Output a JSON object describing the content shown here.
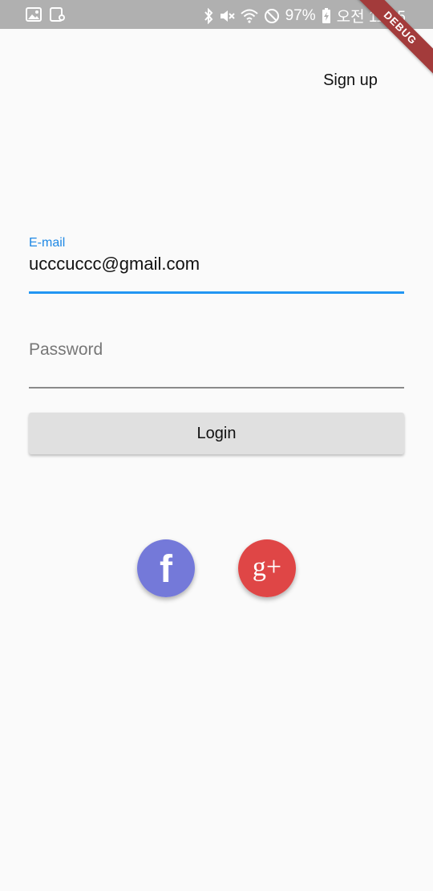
{
  "status_bar": {
    "battery": "97%",
    "time": "오전 11:45",
    "icons": [
      "gallery-icon",
      "screenshot-icon",
      "bluetooth-icon",
      "mute-icon",
      "wifi-icon",
      "do-not-disturb-icon",
      "battery-charging-icon"
    ]
  },
  "debug_banner": "DEBUG",
  "header": {
    "signup_label": "Sign up"
  },
  "form": {
    "email_label": "E-mail",
    "email_value": "ucccuccc@gmail.com",
    "password_placeholder": "Password",
    "login_label": "Login"
  },
  "social": {
    "facebook": {
      "glyph": "f",
      "color": "#7479d9"
    },
    "google_plus": {
      "glyph": "g+",
      "color": "#df4646"
    }
  },
  "colors": {
    "accent": "#2196f3",
    "status_bar": "#b0b0b0",
    "button_bg": "#e0e0e0"
  }
}
